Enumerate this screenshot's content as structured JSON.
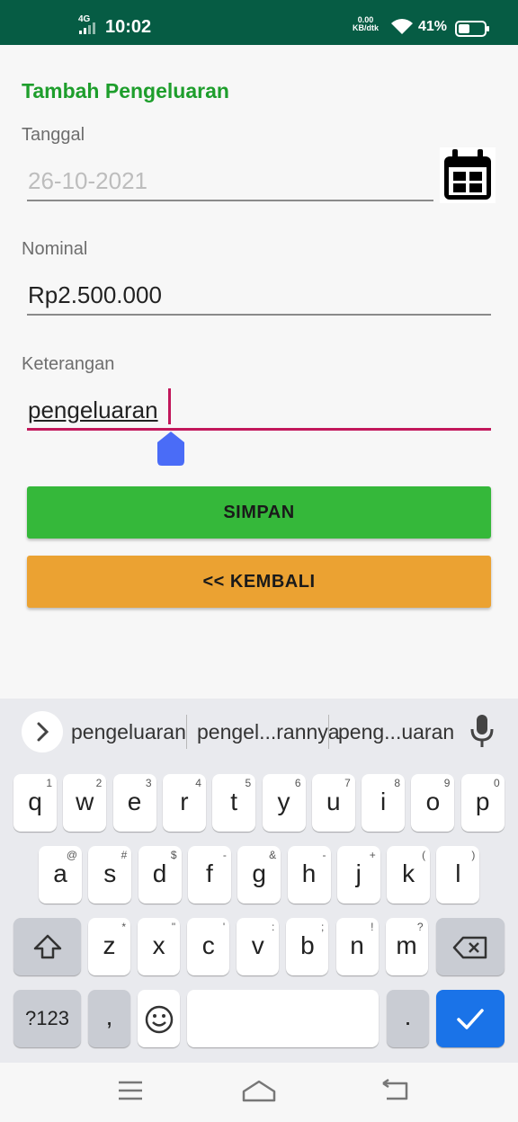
{
  "status": {
    "network": "4G",
    "time": "10:02",
    "speed_value": "0.00",
    "speed_unit": "KB/dtk",
    "battery": "41%"
  },
  "form": {
    "title": "Tambah Pengeluaran",
    "tanggal_label": "Tanggal",
    "tanggal_value": "26-10-2021",
    "nominal_label": "Nominal",
    "nominal_value": "Rp2.500.000",
    "keterangan_label": "Keterangan",
    "keterangan_value": "pengeluaran",
    "save_label": "SIMPAN",
    "back_label": "<< KEMBALI"
  },
  "keyboard": {
    "suggestions": [
      "pengeluaran",
      "pengel...rannya",
      "peng...uaran"
    ],
    "row1": [
      {
        "k": "q",
        "s": "1"
      },
      {
        "k": "w",
        "s": "2"
      },
      {
        "k": "e",
        "s": "3"
      },
      {
        "k": "r",
        "s": "4"
      },
      {
        "k": "t",
        "s": "5"
      },
      {
        "k": "y",
        "s": "6"
      },
      {
        "k": "u",
        "s": "7"
      },
      {
        "k": "i",
        "s": "8"
      },
      {
        "k": "o",
        "s": "9"
      },
      {
        "k": "p",
        "s": "0"
      }
    ],
    "row2": [
      {
        "k": "a",
        "s": "@"
      },
      {
        "k": "s",
        "s": "#"
      },
      {
        "k": "d",
        "s": "$"
      },
      {
        "k": "f",
        "s": "-"
      },
      {
        "k": "g",
        "s": "&"
      },
      {
        "k": "h",
        "s": "-"
      },
      {
        "k": "j",
        "s": "+"
      },
      {
        "k": "k",
        "s": "("
      },
      {
        "k": "l",
        "s": ")"
      }
    ],
    "row3": [
      {
        "k": "z",
        "s": "*"
      },
      {
        "k": "x",
        "s": "\""
      },
      {
        "k": "c",
        "s": "'"
      },
      {
        "k": "v",
        "s": ":"
      },
      {
        "k": "b",
        "s": ";"
      },
      {
        "k": "n",
        "s": "!"
      },
      {
        "k": "m",
        "s": "?"
      }
    ],
    "symbols_label": "?123",
    "comma": ",",
    "period": "."
  }
}
